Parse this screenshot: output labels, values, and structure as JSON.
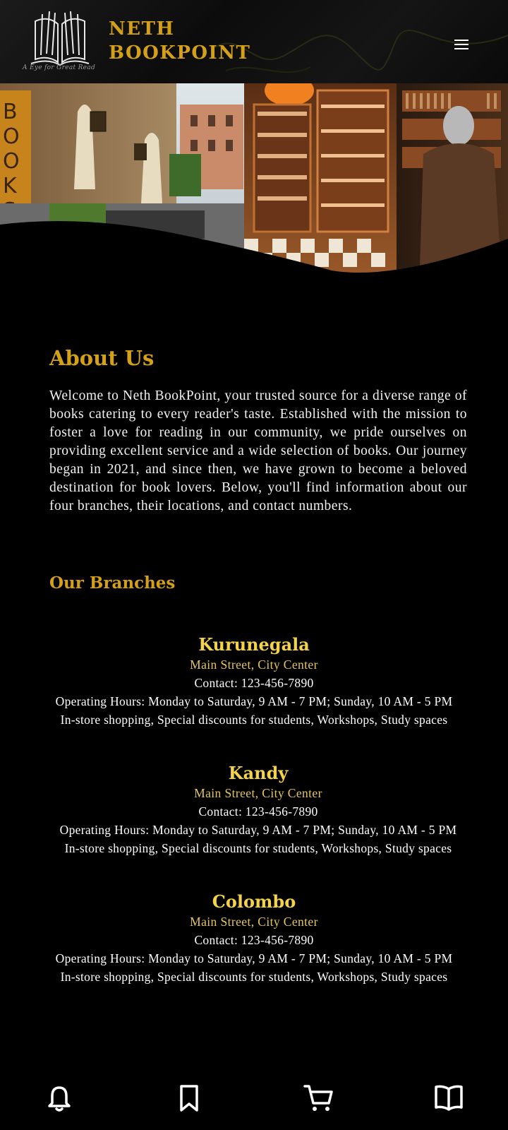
{
  "header": {
    "brand_line1": "NETH",
    "brand_line2": "BOOKPOINT",
    "tagline": "A Eye for Great Read",
    "menu_icon": "hamburger-menu-icon",
    "accent_color": "#d4a017"
  },
  "hero": {
    "sign_text": "BOOKSH"
  },
  "about": {
    "title": "About Us",
    "text": "Welcome to Neth BookPoint, your trusted source for a diverse range of books catering to every reader's taste. Established with the mission to foster a love for reading in our community, we pride ourselves on providing excellent service and a wide selection of books. Our journey began in 2021, and since then, we have grown to become a beloved destination for book lovers. Below, you'll find information about our four branches, their locations, and contact numbers."
  },
  "branches": {
    "title": "Our Branches",
    "items": [
      {
        "name": "Kurunegala",
        "address": "Main Street, City Center",
        "contact": "Contact: 123-456-7890",
        "hours": "Operating Hours: Monday to Saturday, 9 AM - 7 PM; Sunday, 10 AM - 5 PM",
        "services": "In-store shopping, Special discounts for students, Workshops, Study spaces"
      },
      {
        "name": "Kandy",
        "address": "Main Street, City Center",
        "contact": "Contact: 123-456-7890",
        "hours": "Operating Hours: Monday to Saturday, 9 AM - 7 PM; Sunday, 10 AM - 5 PM",
        "services": "In-store shopping, Special discounts for students, Workshops, Study spaces"
      },
      {
        "name": "Colombo",
        "address": "Main Street, City Center",
        "contact": "Contact: 123-456-7890",
        "hours": "Operating Hours: Monday to Saturday, 9 AM - 7 PM; Sunday, 10 AM - 5 PM",
        "services": "In-store shopping, Special discounts for students, Workshops, Study spaces"
      }
    ]
  },
  "bottom_nav": {
    "items": [
      "bell-icon",
      "bookmark-icon",
      "cart-icon",
      "open-book-icon"
    ]
  }
}
